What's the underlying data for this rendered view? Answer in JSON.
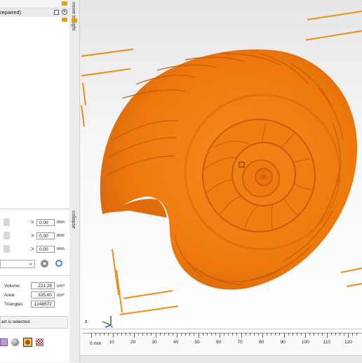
{
  "tree": {
    "item_label": "repaired)"
  },
  "sidebar_tabs": {
    "top": "move to right",
    "bottom": "collapse"
  },
  "transform": {
    "rows": [
      {
        "arrow": ">",
        "value": "0.00",
        "unit": "mm"
      },
      {
        "arrow": ">",
        "value": "0.00",
        "unit": "mm"
      },
      {
        "arrow": ">",
        "value": "0.00",
        "unit": "mm"
      }
    ]
  },
  "stats": {
    "volume_label": "Volume:",
    "volume_value": "221.29",
    "volume_unit": "cm³",
    "area_label": "Area:",
    "area_value": "325.60",
    "area_unit": "cm²",
    "triangles_label": "Triangles:",
    "triangles_value": "1248572"
  },
  "status": {
    "message": "art is selected."
  },
  "ruler": {
    "unit_label": "0 mm",
    "ticks": [
      "10",
      "20",
      "30",
      "40",
      "50",
      "60",
      "70",
      "80",
      "90",
      "100",
      "110",
      "120"
    ]
  },
  "axes": {
    "z": "z",
    "x": "x"
  },
  "colors": {
    "model": "#f07a0d",
    "print_bed_lines": "#f08a1c",
    "accent": "#3a7bd5"
  }
}
